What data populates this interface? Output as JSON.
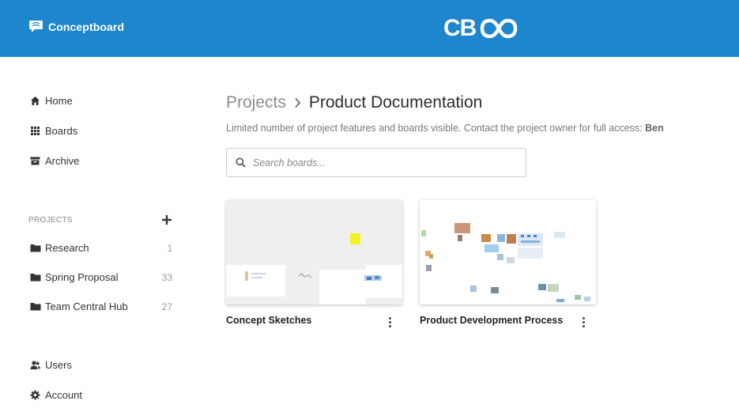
{
  "header": {
    "brand_name": "Conceptboard",
    "brand_icon": "speech-bubble-logo-icon",
    "center_logo_text": "CB",
    "accent_color": "#1e86cc"
  },
  "sidebar": {
    "nav": [
      {
        "label": "Home",
        "icon": "home-icon"
      },
      {
        "label": "Boards",
        "icon": "grid-icon"
      },
      {
        "label": "Archive",
        "icon": "archive-icon"
      }
    ],
    "projects_title": "PROJECTS",
    "projects": [
      {
        "name": "Research",
        "count": "1"
      },
      {
        "name": "Spring Proposal",
        "count": "33"
      },
      {
        "name": "Team Central Hub",
        "count": "27"
      }
    ],
    "bottom": [
      {
        "label": "Users",
        "icon": "users-icon"
      },
      {
        "label": "Account",
        "icon": "gear-icon"
      }
    ]
  },
  "main": {
    "breadcrumb": {
      "parent": "Projects",
      "current": "Product Documentation"
    },
    "notice_text": "Limited number of project features and boards visible. Contact the project owner for full access: ",
    "notice_owner": "Ben",
    "search": {
      "placeholder": "Search boards...",
      "value": ""
    },
    "boards": [
      {
        "title": "Concept Sketches"
      },
      {
        "title": "Product Development Process"
      }
    ]
  }
}
